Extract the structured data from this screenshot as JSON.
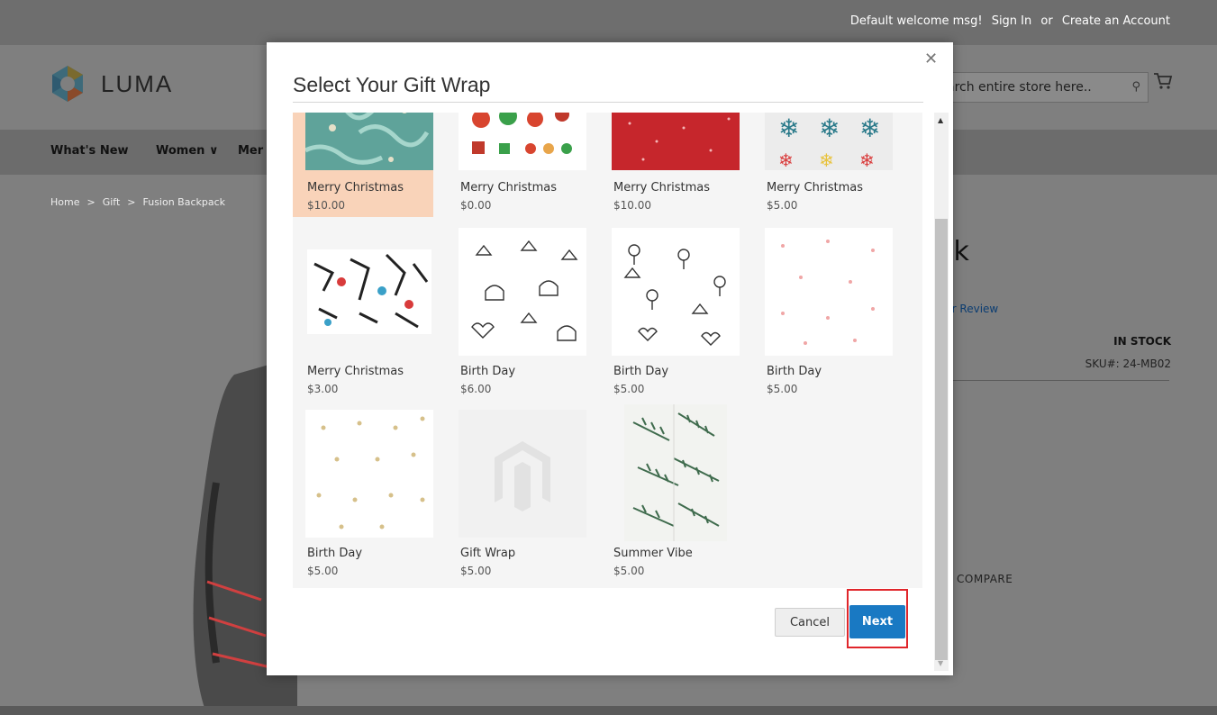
{
  "top_links": {
    "welcome": "Default welcome msg!",
    "sign_in": "Sign In",
    "or": "or",
    "create_account": "Create an Account"
  },
  "header": {
    "logo_text": "LUMA",
    "search_placeholder": "arch entire store here..",
    "search_icon": "search-icon",
    "cart_icon": "cart-icon"
  },
  "nav": {
    "items": [
      "What's New",
      "Women ∨",
      "Mer"
    ]
  },
  "breadcrumb": {
    "items": [
      "Home",
      "Gift",
      "Fusion Backpack"
    ],
    "separator": ">"
  },
  "product": {
    "title_fragment": "ck",
    "review_fragment": "Your Review",
    "stock": "IN STOCK",
    "sku": "SKU#:  24-MB02",
    "compare_fragment": "D COMPARE"
  },
  "modal": {
    "title": "Select Your Gift Wrap",
    "close_icon": "close-icon",
    "items": [
      {
        "name": "Merry Christmas",
        "price": "$10.00",
        "selected": true,
        "pattern": "holly-teal"
      },
      {
        "name": "Merry Christmas",
        "price": "$0.00",
        "selected": false,
        "pattern": "candy"
      },
      {
        "name": "Merry Christmas",
        "price": "$10.00",
        "selected": false,
        "pattern": "red-dots"
      },
      {
        "name": "Merry Christmas",
        "price": "$5.00",
        "selected": false,
        "pattern": "snowflakes"
      },
      {
        "name": "Merry Christmas",
        "price": "$3.00",
        "selected": false,
        "pattern": "santa-doodle"
      },
      {
        "name": "Birth Day",
        "price": "$6.00",
        "selected": false,
        "pattern": "cupcake-doodle"
      },
      {
        "name": "Birth Day",
        "price": "$5.00",
        "selected": false,
        "pattern": "balloon-doodle"
      },
      {
        "name": "Birth Day",
        "price": "$5.00",
        "selected": false,
        "pattern": "pink-hearts"
      },
      {
        "name": "Birth Day",
        "price": "$5.00",
        "selected": false,
        "pattern": "gold-hearts"
      },
      {
        "name": "Gift Wrap",
        "price": "$5.00",
        "selected": false,
        "pattern": "magento-placeholder"
      },
      {
        "name": "Summer Vibe",
        "price": "$5.00",
        "selected": false,
        "pattern": "palm-leaves"
      }
    ],
    "cancel_label": "Cancel",
    "next_label": "Next"
  },
  "colors": {
    "accent": "#1979c3",
    "selected_bg": "#f9d3b9",
    "highlight_box": "#e0262b"
  }
}
